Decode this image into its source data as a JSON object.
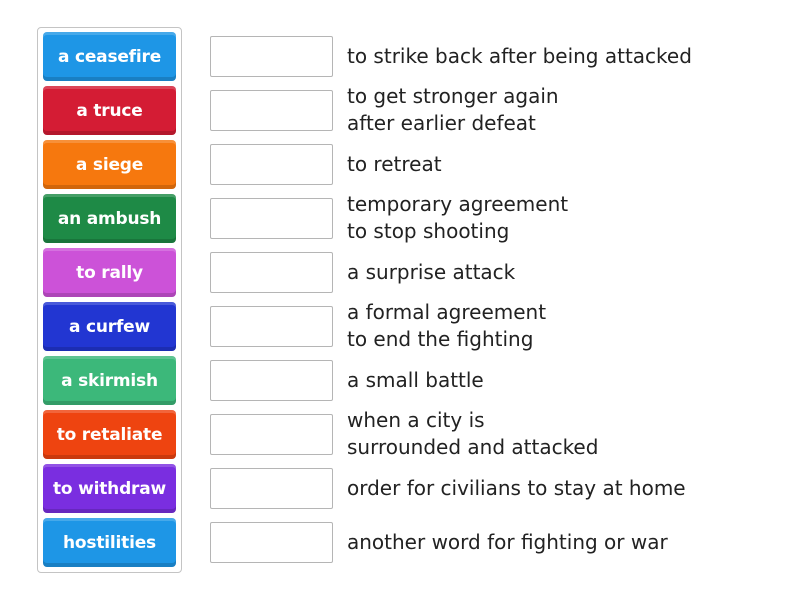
{
  "tiles": [
    {
      "label": "a ceasefire",
      "color": "#1e96e6"
    },
    {
      "label": "a truce",
      "color": "#d41c34"
    },
    {
      "label": "a siege",
      "color": "#f6780e"
    },
    {
      "label": "an ambush",
      "color": "#1e8a46"
    },
    {
      "label": "to rally",
      "color": "#cc52d8"
    },
    {
      "label": "a curfew",
      "color": "#2236d2"
    },
    {
      "label": "a skirmish",
      "color": "#3cb87a"
    },
    {
      "label": "to retaliate",
      "color": "#ee4410"
    },
    {
      "label": "to withdraw",
      "color": "#7a2ee0"
    },
    {
      "label": "hostilities",
      "color": "#1e96e6"
    }
  ],
  "definitions": [
    {
      "text": "to strike back after being attacked",
      "answer": ""
    },
    {
      "text": "to get stronger again\nafter earlier defeat",
      "answer": ""
    },
    {
      "text": "to retreat",
      "answer": ""
    },
    {
      "text": "temporary agreement\nto stop shooting",
      "answer": ""
    },
    {
      "text": "a surprise attack",
      "answer": ""
    },
    {
      "text": "a formal agreement\nto end the fighting",
      "answer": ""
    },
    {
      "text": "a small battle",
      "answer": ""
    },
    {
      "text": "when a city is\nsurrounded and attacked",
      "answer": ""
    },
    {
      "text": "order for civilians to stay at home",
      "answer": ""
    },
    {
      "text": "another word for fighting or war",
      "answer": ""
    }
  ]
}
